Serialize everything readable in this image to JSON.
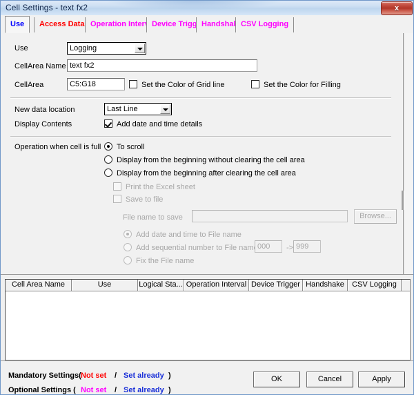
{
  "window": {
    "title": "Cell Settings - text fx2",
    "close_label": "x"
  },
  "tabs": [
    {
      "label": "Use",
      "color": "#0000ff",
      "selected": true
    },
    {
      "label": "Access Data",
      "color": "#ff0000",
      "selected": false
    },
    {
      "label": "Operation Interval",
      "color": "#ff00ff",
      "selected": false
    },
    {
      "label": "Device Trigger",
      "color": "#ff00ff",
      "selected": false
    },
    {
      "label": "Handshake",
      "color": "#ff00ff",
      "selected": false
    },
    {
      "label": "CSV Logging",
      "color": "#ff00ff",
      "selected": false
    }
  ],
  "form": {
    "use_label": "Use",
    "use_value": "Logging",
    "cell_area_name_label": "CellArea Name",
    "cell_area_name_value": "text fx2",
    "cell_area_label": "CellArea",
    "cell_area_value": "C5:G18",
    "set_color_grid_label": "Set the Color of Grid line",
    "set_color_fill_label": "Set the Color for Filling",
    "new_data_location_label": "New data location",
    "new_data_location_value": "Last Line",
    "display_contents_label": "Display Contents",
    "add_date_time_label": "Add date and time details",
    "operation_full_label": "Operation when cell is full",
    "opt_scroll": "To scroll",
    "opt_begin_no_clear": "Display from the beginning without clearing the cell area",
    "opt_begin_clear": "Display from the beginning after clearing the cell area",
    "print_excel_label": "Print the Excel sheet",
    "save_to_file_label": "Save to file",
    "file_name_label": "File name to save",
    "file_name_value": "",
    "browse_label": "Browse...",
    "fn_add_datetime": "Add date and time to File name",
    "fn_add_seq": "Add sequential number to File name",
    "fn_seq_from": "000",
    "fn_seq_arrow": "->",
    "fn_seq_to": "999",
    "fn_fix": "Fix the File name"
  },
  "table": {
    "columns": [
      "Cell Area Name",
      "Use",
      "Logical Sta...",
      "Operation Interval",
      "Device Trigger",
      "Handshake",
      "CSV Logging",
      ""
    ],
    "rows": []
  },
  "footer": {
    "mandatory_label": "Mandatory Settings(",
    "mandatory_notset": "Not set",
    "mandatory_slash": "/",
    "mandatory_setalready": "Set already",
    "mandatory_close": ")",
    "optional_label": "Optional Settings  (",
    "optional_notset": "Not set",
    "optional_slash": "/",
    "optional_setalready": "Set already",
    "optional_close": ")",
    "ok_label": "OK",
    "cancel_label": "Cancel",
    "apply_label": "Apply"
  }
}
